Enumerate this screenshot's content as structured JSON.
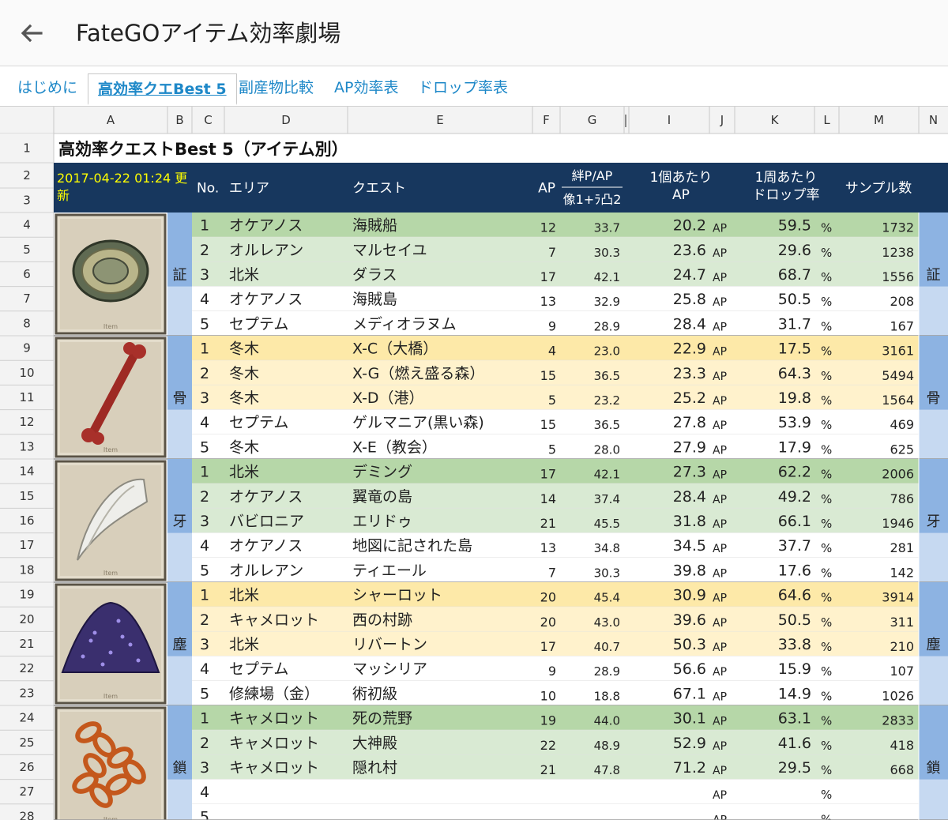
{
  "app": {
    "title": "FateGOアイテム効率劇場"
  },
  "tabs": [
    "はじめに",
    "高効率クエBest 5",
    "副産物比較",
    "AP効率表",
    "ドロップ率表"
  ],
  "active_tab": 1,
  "columns": [
    "A",
    "B",
    "C",
    "D",
    "E",
    "F",
    "G",
    "I",
    "J",
    "K",
    "L",
    "M",
    "N"
  ],
  "row_numbers": [
    "1",
    "2",
    "3",
    "4",
    "5",
    "6",
    "7",
    "8",
    "9",
    "10",
    "11",
    "12",
    "13",
    "14",
    "15",
    "16",
    "17",
    "18",
    "19",
    "20",
    "21",
    "22",
    "23",
    "24",
    "25",
    "26",
    "27",
    "28"
  ],
  "sheet_title": "高効率クエストBest 5（アイテム別）",
  "updated": "2017-04-22 01:24 更新",
  "headers": {
    "no": "No.",
    "area": "エリア",
    "quest": "クエスト",
    "ap": "AP",
    "kizuna_top": "絆P/AP",
    "kizuna_bottom": "像1+ﾗ凸2",
    "per_item_top": "1個あたり",
    "per_item_bottom": "AP",
    "drop_top": "1周あたり",
    "drop_bottom": "ドロップ率",
    "sample": "サンプル数"
  },
  "colors": {
    "header_bg": "#17375e",
    "header_text": "#ffffff",
    "date_text": "#ffff00",
    "green_dark": "#b6d7a8",
    "green_light": "#d9ead3",
    "yellow_dark": "#fde9a8",
    "yellow_light": "#fff2cc",
    "side_blue_dark": "#8db3e2",
    "side_blue_light": "#c6d9f1"
  },
  "groups": [
    {
      "label": "証",
      "icon": "evidence-icon",
      "color": "green",
      "rows": [
        {
          "no": "1",
          "area": "オケアノス",
          "quest": "海賊船",
          "ap": "12",
          "kizuna": "33.7",
          "per_ap": "20.2",
          "unit": "AP",
          "drop": "59.5",
          "pct": "%",
          "samples": "1732"
        },
        {
          "no": "2",
          "area": "オルレアン",
          "quest": "マルセイユ",
          "ap": "7",
          "kizuna": "30.3",
          "per_ap": "23.6",
          "unit": "AP",
          "drop": "29.6",
          "pct": "%",
          "samples": "1238"
        },
        {
          "no": "3",
          "area": "北米",
          "quest": "ダラス",
          "ap": "17",
          "kizuna": "42.1",
          "per_ap": "24.7",
          "unit": "AP",
          "drop": "68.7",
          "pct": "%",
          "samples": "1556"
        },
        {
          "no": "4",
          "area": "オケアノス",
          "quest": "海賊島",
          "ap": "13",
          "kizuna": "32.9",
          "per_ap": "25.8",
          "unit": "AP",
          "drop": "50.5",
          "pct": "%",
          "samples": "208"
        },
        {
          "no": "5",
          "area": "セプテム",
          "quest": "メディオラヌム",
          "ap": "9",
          "kizuna": "28.9",
          "per_ap": "28.4",
          "unit": "AP",
          "drop": "31.7",
          "pct": "%",
          "samples": "167"
        }
      ]
    },
    {
      "label": "骨",
      "icon": "bone-icon",
      "color": "yellow",
      "rows": [
        {
          "no": "1",
          "area": "冬木",
          "quest": "X-C（大橋）",
          "ap": "4",
          "kizuna": "23.0",
          "per_ap": "22.9",
          "unit": "AP",
          "drop": "17.5",
          "pct": "%",
          "samples": "3161"
        },
        {
          "no": "2",
          "area": "冬木",
          "quest": "X-G（燃え盛る森）",
          "ap": "15",
          "kizuna": "36.5",
          "per_ap": "23.3",
          "unit": "AP",
          "drop": "64.3",
          "pct": "%",
          "samples": "5494"
        },
        {
          "no": "3",
          "area": "冬木",
          "quest": "X-D（港）",
          "ap": "5",
          "kizuna": "23.2",
          "per_ap": "25.2",
          "unit": "AP",
          "drop": "19.8",
          "pct": "%",
          "samples": "1564"
        },
        {
          "no": "4",
          "area": "セプテム",
          "quest": "ゲルマニア(黒い森)",
          "ap": "15",
          "kizuna": "36.5",
          "per_ap": "27.8",
          "unit": "AP",
          "drop": "53.9",
          "pct": "%",
          "samples": "469"
        },
        {
          "no": "5",
          "area": "冬木",
          "quest": "X-E（教会）",
          "ap": "5",
          "kizuna": "28.0",
          "per_ap": "27.9",
          "unit": "AP",
          "drop": "17.9",
          "pct": "%",
          "samples": "625"
        }
      ]
    },
    {
      "label": "牙",
      "icon": "fang-icon",
      "color": "green",
      "rows": [
        {
          "no": "1",
          "area": "北米",
          "quest": "デミング",
          "ap": "17",
          "kizuna": "42.1",
          "per_ap": "27.3",
          "unit": "AP",
          "drop": "62.2",
          "pct": "%",
          "samples": "2006"
        },
        {
          "no": "2",
          "area": "オケアノス",
          "quest": "翼竜の島",
          "ap": "14",
          "kizuna": "37.4",
          "per_ap": "28.4",
          "unit": "AP",
          "drop": "49.2",
          "pct": "%",
          "samples": "786"
        },
        {
          "no": "3",
          "area": "バビロニア",
          "quest": "エリドゥ",
          "ap": "21",
          "kizuna": "45.5",
          "per_ap": "31.8",
          "unit": "AP",
          "drop": "66.1",
          "pct": "%",
          "samples": "1946"
        },
        {
          "no": "4",
          "area": "オケアノス",
          "quest": "地図に記された島",
          "ap": "13",
          "kizuna": "34.8",
          "per_ap": "34.5",
          "unit": "AP",
          "drop": "37.7",
          "pct": "%",
          "samples": "281"
        },
        {
          "no": "5",
          "area": "オルレアン",
          "quest": "ティエール",
          "ap": "7",
          "kizuna": "30.3",
          "per_ap": "39.8",
          "unit": "AP",
          "drop": "17.6",
          "pct": "%",
          "samples": "142"
        }
      ]
    },
    {
      "label": "塵",
      "icon": "dust-icon",
      "color": "yellow",
      "rows": [
        {
          "no": "1",
          "area": "北米",
          "quest": "シャーロット",
          "ap": "20",
          "kizuna": "45.4",
          "per_ap": "30.9",
          "unit": "AP",
          "drop": "64.6",
          "pct": "%",
          "samples": "3914"
        },
        {
          "no": "2",
          "area": "キャメロット",
          "quest": "西の村跡",
          "ap": "20",
          "kizuna": "43.0",
          "per_ap": "39.6",
          "unit": "AP",
          "drop": "50.5",
          "pct": "%",
          "samples": "311"
        },
        {
          "no": "3",
          "area": "北米",
          "quest": "リバートン",
          "ap": "17",
          "kizuna": "40.7",
          "per_ap": "50.3",
          "unit": "AP",
          "drop": "33.8",
          "pct": "%",
          "samples": "210"
        },
        {
          "no": "4",
          "area": "セプテム",
          "quest": "マッシリア",
          "ap": "9",
          "kizuna": "28.9",
          "per_ap": "56.6",
          "unit": "AP",
          "drop": "15.9",
          "pct": "%",
          "samples": "107"
        },
        {
          "no": "5",
          "area": "修練場（金）",
          "quest": "術初級",
          "ap": "10",
          "kizuna": "18.8",
          "per_ap": "67.1",
          "unit": "AP",
          "drop": "14.9",
          "pct": "%",
          "samples": "1026"
        }
      ]
    },
    {
      "label": "鎖",
      "icon": "chain-icon",
      "color": "green",
      "rows": [
        {
          "no": "1",
          "area": "キャメロット",
          "quest": "死の荒野",
          "ap": "19",
          "kizuna": "44.0",
          "per_ap": "30.1",
          "unit": "AP",
          "drop": "63.1",
          "pct": "%",
          "samples": "2833"
        },
        {
          "no": "2",
          "area": "キャメロット",
          "quest": "大神殿",
          "ap": "22",
          "kizuna": "48.9",
          "per_ap": "52.9",
          "unit": "AP",
          "drop": "41.6",
          "pct": "%",
          "samples": "418"
        },
        {
          "no": "3",
          "area": "キャメロット",
          "quest": "隠れ村",
          "ap": "21",
          "kizuna": "47.8",
          "per_ap": "71.2",
          "unit": "AP",
          "drop": "29.5",
          "pct": "%",
          "samples": "668"
        },
        {
          "no": "4",
          "area": "",
          "quest": "",
          "ap": "",
          "kizuna": "",
          "per_ap": "",
          "unit": "AP",
          "drop": "",
          "pct": "%",
          "samples": ""
        },
        {
          "no": "5",
          "area": "",
          "quest": "",
          "ap": "",
          "kizuna": "",
          "per_ap": "",
          "unit": "AP",
          "drop": "",
          "pct": "%",
          "samples": ""
        }
      ]
    }
  ],
  "item_caption": "Item"
}
